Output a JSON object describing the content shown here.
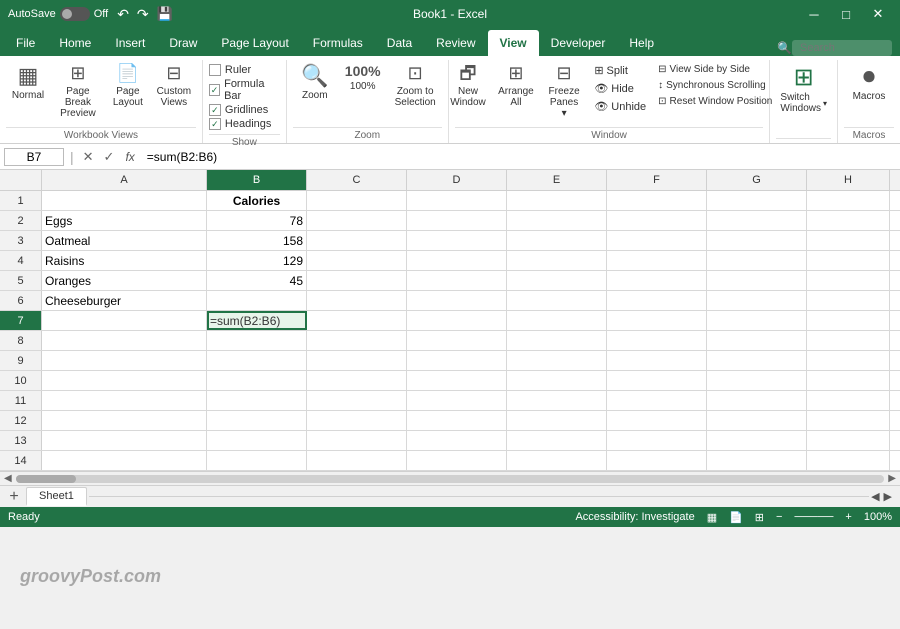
{
  "titleBar": {
    "autoSave": "AutoSave",
    "off": "Off",
    "title": "Book1 - Excel",
    "windowControls": {
      "minimize": "─",
      "maximize": "□",
      "close": "✕"
    }
  },
  "ribbon": {
    "tabs": [
      "File",
      "Home",
      "Insert",
      "Draw",
      "Page Layout",
      "Formulas",
      "Data",
      "Review",
      "View",
      "Developer",
      "Help"
    ],
    "activeTab": "View",
    "groups": {
      "workbookViews": {
        "label": "Workbook Views",
        "buttons": [
          {
            "icon": "▦",
            "label": "Normal"
          },
          {
            "icon": "⊞",
            "label": "Page Break\nPreview"
          },
          {
            "icon": "📄",
            "label": "Page\nLayout"
          },
          {
            "icon": "⊟",
            "label": "Custom\nViews"
          }
        ]
      },
      "show": {
        "label": "Show",
        "checks": [
          {
            "label": "Ruler",
            "checked": false
          },
          {
            "label": "Formula Bar",
            "checked": true
          },
          {
            "label": "Gridlines",
            "checked": true
          },
          {
            "label": "Headings",
            "checked": true
          }
        ]
      },
      "zoom": {
        "label": "Zoom",
        "buttons": [
          {
            "icon": "🔍",
            "label": "Zoom"
          },
          {
            "icon": "100%",
            "label": "100%"
          },
          {
            "icon": "⊡",
            "label": "Zoom to\nSelection"
          }
        ]
      },
      "window": {
        "label": "Window",
        "buttons": [
          {
            "label": "New\nWindow"
          },
          {
            "label": "Arrange\nAll"
          },
          {
            "label": "Freeze\nPanes ▾"
          }
        ],
        "rightButtons": [
          {
            "label": "Split"
          },
          {
            "label": "Hide"
          },
          {
            "label": "Unhide"
          }
        ],
        "farRight": [
          {
            "label": "View Side by Side"
          },
          {
            "label": "Synchronous Scrolling"
          },
          {
            "label": "Reset Window Position"
          }
        ]
      },
      "switchWindows": {
        "label": "Switch\nWindows ▾",
        "icon": "⊞"
      },
      "macros": {
        "label": "Macros",
        "icon": "⏺"
      }
    }
  },
  "formulaBar": {
    "cellRef": "B7",
    "formula": "=sum(B2:B6)"
  },
  "columns": [
    "A",
    "B",
    "C",
    "D",
    "E",
    "F",
    "G",
    "H"
  ],
  "rows": [
    {
      "num": 1,
      "cells": [
        "",
        "Calories",
        "",
        "",
        "",
        "",
        "",
        ""
      ]
    },
    {
      "num": 2,
      "cells": [
        "Eggs",
        "78",
        "",
        "",
        "",
        "",
        "",
        ""
      ]
    },
    {
      "num": 3,
      "cells": [
        "Oatmeal",
        "158",
        "",
        "",
        "",
        "",
        "",
        ""
      ]
    },
    {
      "num": 4,
      "cells": [
        "Raisins",
        "129",
        "",
        "",
        "",
        "",
        "",
        ""
      ]
    },
    {
      "num": 5,
      "cells": [
        "Oranges",
        "45",
        "",
        "",
        "",
        "",
        "",
        ""
      ]
    },
    {
      "num": 6,
      "cells": [
        "Cheeseburger",
        "",
        "",
        "",
        "",
        "",
        "",
        ""
      ]
    },
    {
      "num": 7,
      "cells": [
        "",
        "=sum(B2:B6)",
        "",
        "",
        "",
        "",
        "",
        ""
      ]
    },
    {
      "num": 8,
      "cells": [
        "",
        "",
        "",
        "",
        "",
        "",
        "",
        ""
      ]
    },
    {
      "num": 9,
      "cells": [
        "",
        "",
        "",
        "",
        "",
        "",
        "",
        ""
      ]
    },
    {
      "num": 10,
      "cells": [
        "",
        "",
        "",
        "",
        "",
        "",
        "",
        ""
      ]
    },
    {
      "num": 11,
      "cells": [
        "",
        "",
        "",
        "",
        "",
        "",
        "",
        ""
      ]
    },
    {
      "num": 12,
      "cells": [
        "",
        "",
        "",
        "",
        "",
        "",
        "",
        ""
      ]
    },
    {
      "num": 13,
      "cells": [
        "",
        "",
        "",
        "",
        "",
        "",
        "",
        ""
      ]
    },
    {
      "num": 14,
      "cells": [
        "",
        "",
        "",
        "",
        "",
        "",
        "",
        ""
      ]
    }
  ],
  "selectedCell": {
    "row": 7,
    "col": "B"
  },
  "sheetTabs": [
    "Sheet1"
  ],
  "activeSheet": "Sheet1",
  "watermark": "groovyPost.com",
  "statusBar": {
    "ready": "Ready",
    "accessibility": "Accessibility: Investigate"
  },
  "search": {
    "placeholder": "Search"
  }
}
